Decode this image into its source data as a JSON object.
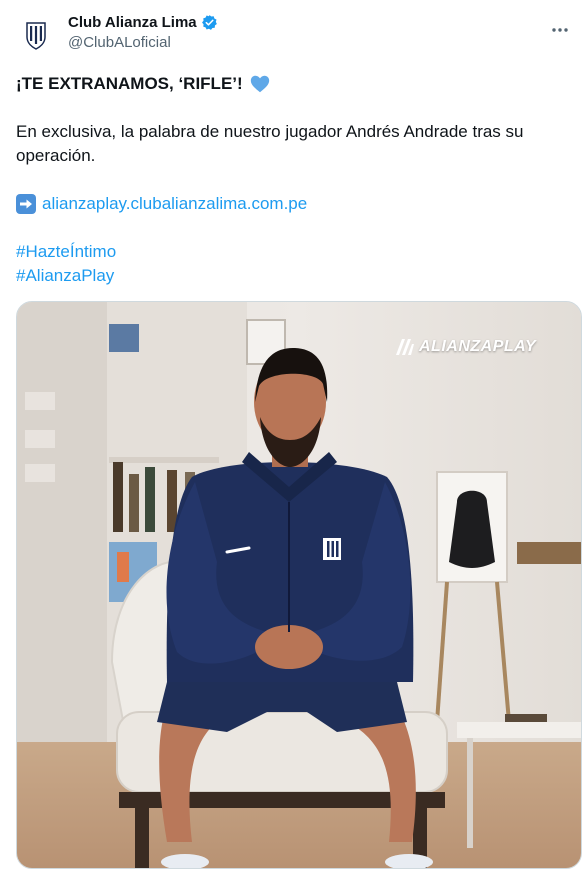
{
  "tweet": {
    "display_name": "Club Alianza Lima",
    "handle": "@ClubALoficial",
    "headline": "¡TE EXTRANAMOS, ‘RIFLE’!",
    "paragraph": "En exclusiva, la palabra de nuestro jugador Andrés Andrade tras su operación.",
    "link": "alianzaplay.clubalianzalima.com.pe",
    "hashtags": [
      "#HazteÍntimo",
      "#AlianzaPlay"
    ],
    "media_watermark": "ALIANZAPLAY",
    "icons": {
      "avatar": "club-crest-icon",
      "verified": "verified-badge-icon",
      "more": "more-options-icon",
      "heart": "blue-heart-icon",
      "link_arrow": "right-arrow-emoji-icon",
      "watermark": "alianzaplay-logo-icon"
    },
    "colors": {
      "link": "#1d9bf0",
      "text": "#0f1419",
      "secondary": "#536471",
      "verified": "#1d9bf0",
      "heart": "#5fa8e8"
    }
  }
}
